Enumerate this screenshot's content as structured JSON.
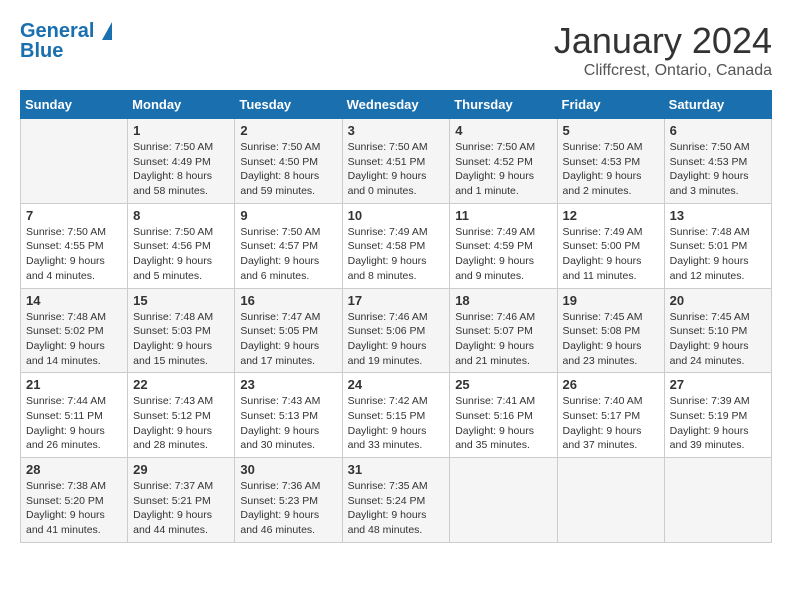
{
  "header": {
    "logo_line1": "General",
    "logo_line2": "Blue",
    "title": "January 2024",
    "subtitle": "Cliffcrest, Ontario, Canada"
  },
  "days_of_week": [
    "Sunday",
    "Monday",
    "Tuesday",
    "Wednesday",
    "Thursday",
    "Friday",
    "Saturday"
  ],
  "weeks": [
    [
      {
        "day": "",
        "info": ""
      },
      {
        "day": "1",
        "info": "Sunrise: 7:50 AM\nSunset: 4:49 PM\nDaylight: 8 hours\nand 58 minutes."
      },
      {
        "day": "2",
        "info": "Sunrise: 7:50 AM\nSunset: 4:50 PM\nDaylight: 8 hours\nand 59 minutes."
      },
      {
        "day": "3",
        "info": "Sunrise: 7:50 AM\nSunset: 4:51 PM\nDaylight: 9 hours\nand 0 minutes."
      },
      {
        "day": "4",
        "info": "Sunrise: 7:50 AM\nSunset: 4:52 PM\nDaylight: 9 hours\nand 1 minute."
      },
      {
        "day": "5",
        "info": "Sunrise: 7:50 AM\nSunset: 4:53 PM\nDaylight: 9 hours\nand 2 minutes."
      },
      {
        "day": "6",
        "info": "Sunrise: 7:50 AM\nSunset: 4:53 PM\nDaylight: 9 hours\nand 3 minutes."
      }
    ],
    [
      {
        "day": "7",
        "info": "Sunrise: 7:50 AM\nSunset: 4:55 PM\nDaylight: 9 hours\nand 4 minutes."
      },
      {
        "day": "8",
        "info": "Sunrise: 7:50 AM\nSunset: 4:56 PM\nDaylight: 9 hours\nand 5 minutes."
      },
      {
        "day": "9",
        "info": "Sunrise: 7:50 AM\nSunset: 4:57 PM\nDaylight: 9 hours\nand 6 minutes."
      },
      {
        "day": "10",
        "info": "Sunrise: 7:49 AM\nSunset: 4:58 PM\nDaylight: 9 hours\nand 8 minutes."
      },
      {
        "day": "11",
        "info": "Sunrise: 7:49 AM\nSunset: 4:59 PM\nDaylight: 9 hours\nand 9 minutes."
      },
      {
        "day": "12",
        "info": "Sunrise: 7:49 AM\nSunset: 5:00 PM\nDaylight: 9 hours\nand 11 minutes."
      },
      {
        "day": "13",
        "info": "Sunrise: 7:48 AM\nSunset: 5:01 PM\nDaylight: 9 hours\nand 12 minutes."
      }
    ],
    [
      {
        "day": "14",
        "info": "Sunrise: 7:48 AM\nSunset: 5:02 PM\nDaylight: 9 hours\nand 14 minutes."
      },
      {
        "day": "15",
        "info": "Sunrise: 7:48 AM\nSunset: 5:03 PM\nDaylight: 9 hours\nand 15 minutes."
      },
      {
        "day": "16",
        "info": "Sunrise: 7:47 AM\nSunset: 5:05 PM\nDaylight: 9 hours\nand 17 minutes."
      },
      {
        "day": "17",
        "info": "Sunrise: 7:46 AM\nSunset: 5:06 PM\nDaylight: 9 hours\nand 19 minutes."
      },
      {
        "day": "18",
        "info": "Sunrise: 7:46 AM\nSunset: 5:07 PM\nDaylight: 9 hours\nand 21 minutes."
      },
      {
        "day": "19",
        "info": "Sunrise: 7:45 AM\nSunset: 5:08 PM\nDaylight: 9 hours\nand 23 minutes."
      },
      {
        "day": "20",
        "info": "Sunrise: 7:45 AM\nSunset: 5:10 PM\nDaylight: 9 hours\nand 24 minutes."
      }
    ],
    [
      {
        "day": "21",
        "info": "Sunrise: 7:44 AM\nSunset: 5:11 PM\nDaylight: 9 hours\nand 26 minutes."
      },
      {
        "day": "22",
        "info": "Sunrise: 7:43 AM\nSunset: 5:12 PM\nDaylight: 9 hours\nand 28 minutes."
      },
      {
        "day": "23",
        "info": "Sunrise: 7:43 AM\nSunset: 5:13 PM\nDaylight: 9 hours\nand 30 minutes."
      },
      {
        "day": "24",
        "info": "Sunrise: 7:42 AM\nSunset: 5:15 PM\nDaylight: 9 hours\nand 33 minutes."
      },
      {
        "day": "25",
        "info": "Sunrise: 7:41 AM\nSunset: 5:16 PM\nDaylight: 9 hours\nand 35 minutes."
      },
      {
        "day": "26",
        "info": "Sunrise: 7:40 AM\nSunset: 5:17 PM\nDaylight: 9 hours\nand 37 minutes."
      },
      {
        "day": "27",
        "info": "Sunrise: 7:39 AM\nSunset: 5:19 PM\nDaylight: 9 hours\nand 39 minutes."
      }
    ],
    [
      {
        "day": "28",
        "info": "Sunrise: 7:38 AM\nSunset: 5:20 PM\nDaylight: 9 hours\nand 41 minutes."
      },
      {
        "day": "29",
        "info": "Sunrise: 7:37 AM\nSunset: 5:21 PM\nDaylight: 9 hours\nand 44 minutes."
      },
      {
        "day": "30",
        "info": "Sunrise: 7:36 AM\nSunset: 5:23 PM\nDaylight: 9 hours\nand 46 minutes."
      },
      {
        "day": "31",
        "info": "Sunrise: 7:35 AM\nSunset: 5:24 PM\nDaylight: 9 hours\nand 48 minutes."
      },
      {
        "day": "",
        "info": ""
      },
      {
        "day": "",
        "info": ""
      },
      {
        "day": "",
        "info": ""
      }
    ]
  ]
}
